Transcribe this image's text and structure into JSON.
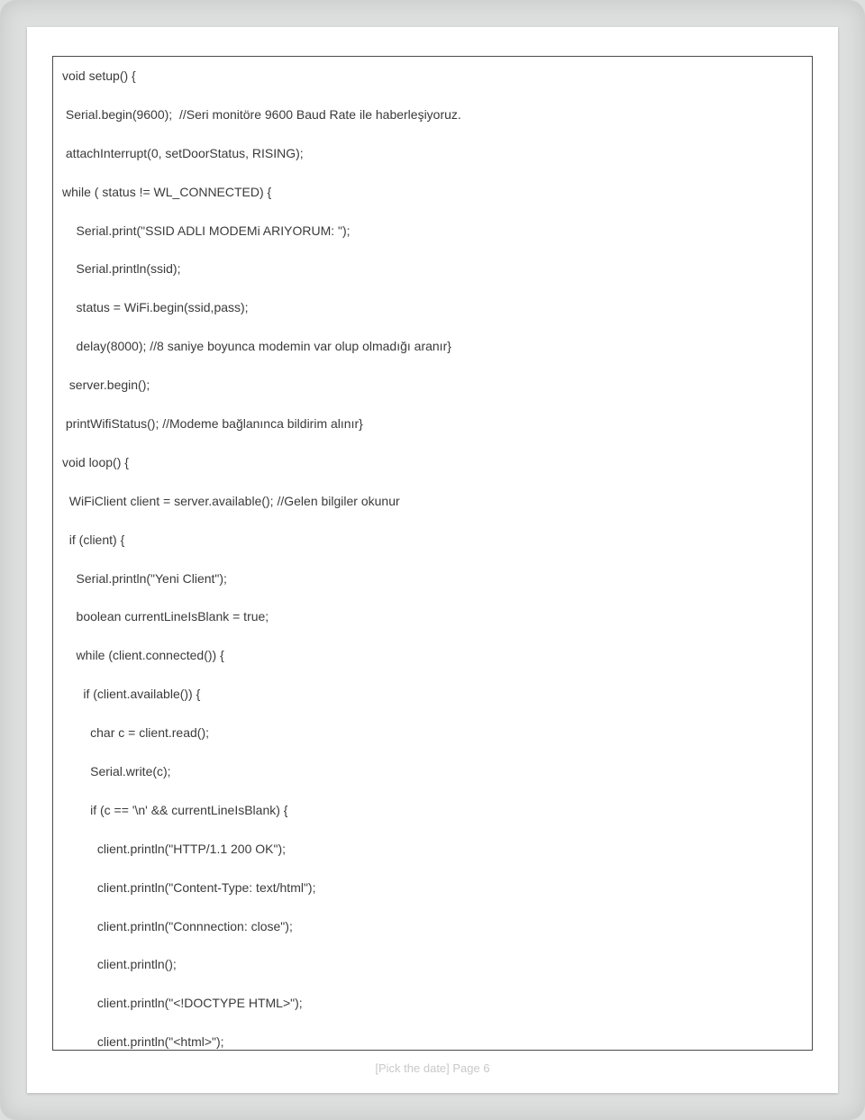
{
  "code": {
    "lines": [
      "void setup() {",
      " Serial.begin(9600);  //Seri monitöre 9600 Baud Rate ile haberleşiyoruz.",
      " attachInterrupt(0, setDoorStatus, RISING);",
      "while ( status != WL_CONNECTED) {",
      "    Serial.print(\"SSID ADLI MODEMi ARIYORUM: \");",
      "    Serial.println(ssid);",
      "    status = WiFi.begin(ssid,pass);",
      "    delay(8000); //8 saniye boyunca modemin var olup olmadığı aranır}",
      "  server.begin();",
      " printWifiStatus(); //Modeme bağlanınca bildirim alınır}",
      "void loop() {",
      "  WiFiClient client = server.available(); //Gelen bilgiler okunur",
      "  if (client) {",
      "    Serial.println(\"Yeni Client\");",
      "    boolean currentLineIsBlank = true;",
      "    while (client.connected()) {",
      "      if (client.available()) {",
      "        char c = client.read();",
      "        Serial.write(c);",
      "        if (c == '\\n' && currentLineIsBlank) {",
      "          client.println(\"HTTP/1.1 200 OK\");",
      "          client.println(\"Content-Type: text/html\");",
      "          client.println(\"Connnection: close\");",
      "          client.println();",
      "          client.println(\"<!DOCTYPE HTML>\");",
      "          client.println(\"<html>\");"
    ]
  },
  "footer": {
    "text": "[Pick the date]  Page 6"
  }
}
